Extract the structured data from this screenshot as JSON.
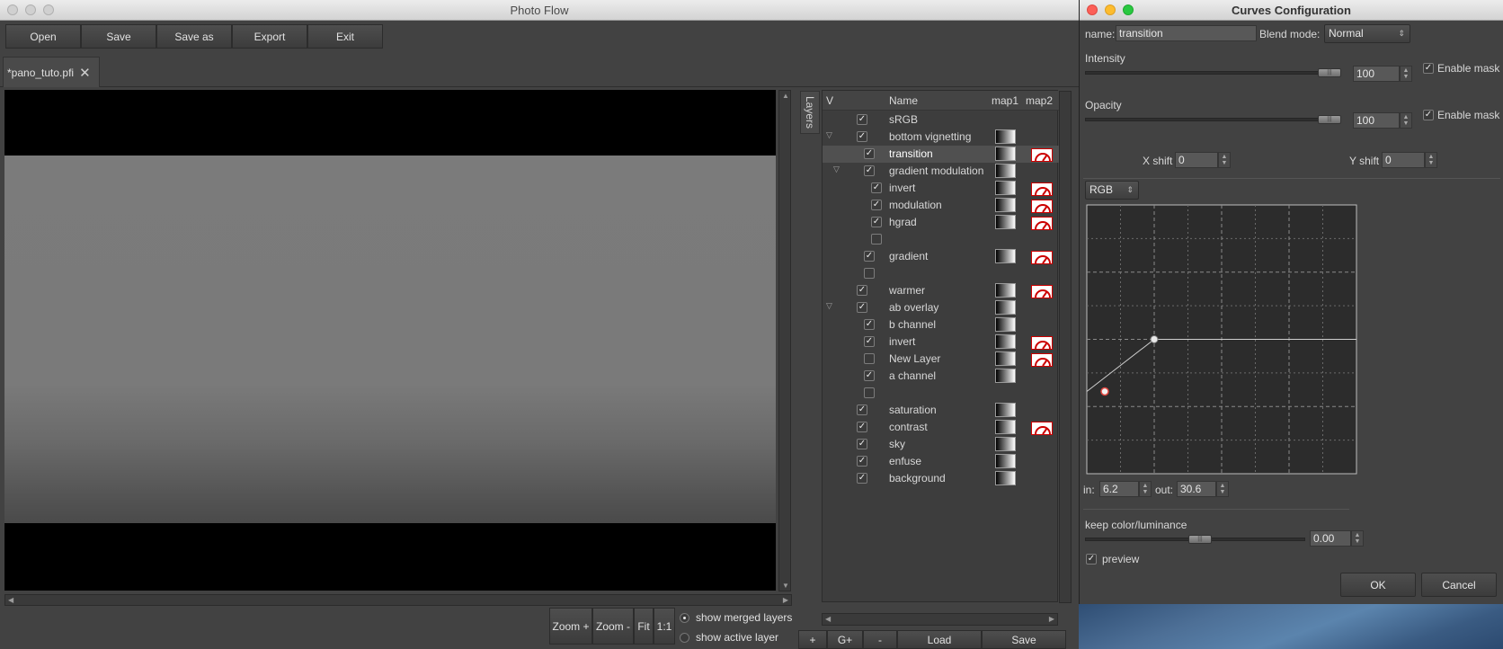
{
  "main_window": {
    "title": "Photo Flow",
    "toolbar": {
      "open": "Open",
      "save": "Save",
      "save_as": "Save as",
      "export": "Export",
      "exit": "Exit"
    },
    "tab": {
      "label": "*pano_tuto.pfi",
      "close": "✕"
    },
    "zoom": {
      "zoom_in": "Zoom +",
      "zoom_out": "Zoom -",
      "fit": "Fit",
      "one_to_one": "1:1"
    },
    "view_mode": {
      "merged": "show merged layers",
      "active": "show active layer",
      "selected": "merged"
    }
  },
  "layers_panel": {
    "tab_label": "Layers",
    "columns": {
      "visible": "V",
      "name": "Name",
      "map1": "map1",
      "map2": "map2"
    },
    "rows": [
      {
        "name": "sRGB",
        "checked": true,
        "indent": 0,
        "expander": false,
        "map1": false,
        "map2": false
      },
      {
        "name": "bottom vignetting",
        "checked": true,
        "indent": 0,
        "expander": true,
        "map1": true,
        "map2": false
      },
      {
        "name": "transition",
        "checked": true,
        "indent": 1,
        "expander": false,
        "map1": true,
        "map2": true,
        "selected": true
      },
      {
        "name": "gradient modulation",
        "checked": true,
        "indent": 1,
        "expander": true,
        "map1": true,
        "map2": false
      },
      {
        "name": "invert",
        "checked": true,
        "indent": 2,
        "expander": false,
        "map1": true,
        "map2": true
      },
      {
        "name": "modulation",
        "checked": true,
        "indent": 2,
        "expander": false,
        "map1": true,
        "map2": true
      },
      {
        "name": "hgrad",
        "checked": true,
        "indent": 2,
        "expander": false,
        "map1": true,
        "map2": true
      },
      {
        "name": "",
        "checked": false,
        "indent": 2,
        "expander": false,
        "map1": false,
        "map2": false
      },
      {
        "name": "gradient",
        "checked": true,
        "indent": 1,
        "expander": false,
        "map1": true,
        "map2": true
      },
      {
        "name": "",
        "checked": false,
        "indent": 1,
        "expander": false,
        "map1": false,
        "map2": false
      },
      {
        "name": "warmer",
        "checked": true,
        "indent": 0,
        "expander": false,
        "map1": true,
        "map2": true
      },
      {
        "name": "ab overlay",
        "checked": true,
        "indent": 0,
        "expander": true,
        "map1": true,
        "map2": false
      },
      {
        "name": "b channel",
        "checked": true,
        "indent": 1,
        "expander": false,
        "map1": true,
        "map2": false
      },
      {
        "name": "invert",
        "checked": true,
        "indent": 1,
        "expander": false,
        "map1": true,
        "map2": true
      },
      {
        "name": "New Layer",
        "checked": false,
        "indent": 1,
        "expander": false,
        "map1": true,
        "map2": true
      },
      {
        "name": "a channel",
        "checked": true,
        "indent": 1,
        "expander": false,
        "map1": true,
        "map2": false
      },
      {
        "name": "",
        "checked": false,
        "indent": 1,
        "expander": false,
        "map1": false,
        "map2": false
      },
      {
        "name": "saturation",
        "checked": true,
        "indent": 0,
        "expander": false,
        "map1": true,
        "map2": false
      },
      {
        "name": "contrast",
        "checked": true,
        "indent": 0,
        "expander": false,
        "map1": true,
        "map2": true
      },
      {
        "name": "sky",
        "checked": true,
        "indent": 0,
        "expander": false,
        "map1": true,
        "map2": false
      },
      {
        "name": "enfuse",
        "checked": true,
        "indent": 0,
        "expander": false,
        "map1": true,
        "map2": false
      },
      {
        "name": "background",
        "checked": true,
        "indent": 0,
        "expander": false,
        "map1": true,
        "map2": false
      }
    ],
    "buttons": {
      "add": "+",
      "add_group": "G+",
      "remove": "-",
      "load": "Load",
      "save": "Save"
    }
  },
  "curves_dialog": {
    "title": "Curves Configuration",
    "name_label": "name:",
    "name_value": "transition",
    "blend_label": "Blend mode:",
    "blend_value": "Normal",
    "intensity": {
      "label": "Intensity",
      "value": "100",
      "mask_label": "Enable mask",
      "mask_checked": true,
      "level": 1.0
    },
    "opacity": {
      "label": "Opacity",
      "value": "100",
      "mask_label": "Enable mask",
      "mask_checked": true,
      "level": 1.0
    },
    "x_shift": {
      "label": "X shift",
      "value": "0"
    },
    "y_shift": {
      "label": "Y shift",
      "value": "0"
    },
    "channel": "RGB",
    "curve_points": [
      {
        "in": 0,
        "out": 30.6
      },
      {
        "in": 25,
        "out": 50
      },
      {
        "in": 100,
        "out": 50
      }
    ],
    "active_point": 0,
    "in_label": "in:",
    "in_value": "6.2",
    "out_label": "out:",
    "out_value": "30.6",
    "keep_label": "keep color/luminance",
    "keep_value": "0.00",
    "preview_label": "preview",
    "preview_checked": true,
    "ok": "OK",
    "cancel": "Cancel",
    "accent": "#e0463f"
  }
}
